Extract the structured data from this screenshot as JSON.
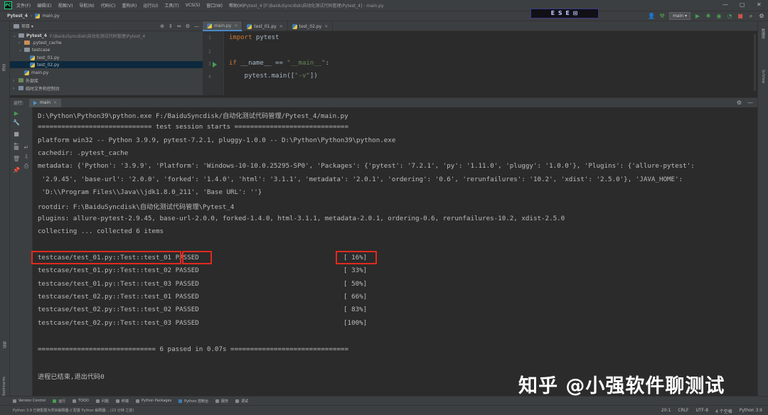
{
  "titlebar": {
    "menu": [
      "文件(F)",
      "编辑(E)",
      "视图(V)",
      "导航(N)",
      "代码(C)",
      "重构(R)",
      "运行(U)",
      "工具(T)",
      "VCS(S)",
      "窗口(W)",
      "帮助(H)"
    ],
    "window_title": "Pytest_4 [F:\\BaiduSyncdisk\\自动化测试代码管理\\Pytest_4] - main.py",
    "logo": "PC",
    "controls": [
      "—",
      "▢",
      "✕"
    ]
  },
  "navbar": {
    "project": "Pytest_4",
    "file": "main.py",
    "banner": "E S E ⊞",
    "run_config": "main ▾"
  },
  "project_panel": {
    "header": "项目 ▾",
    "tree": [
      {
        "label": "Pytest_4",
        "path": "F:\\BaiduSyncdisk\\自动化测试代码管理\\Pytest_4",
        "kind": "folder",
        "expanded": true,
        "indent": 0
      },
      {
        "label": ".pytest_cache",
        "path": "",
        "kind": "folder-excl",
        "expanded": false,
        "indent": 1
      },
      {
        "label": "testcase",
        "path": "",
        "kind": "folder",
        "expanded": true,
        "indent": 1
      },
      {
        "label": "test_01.py",
        "path": "",
        "kind": "py",
        "indent": 2
      },
      {
        "label": "test_02.py",
        "path": "",
        "kind": "py",
        "indent": 2,
        "selected": true
      },
      {
        "label": "main.py",
        "path": "",
        "kind": "py",
        "indent": 1
      },
      {
        "label": "外部库",
        "path": "",
        "kind": "lib",
        "expanded": false,
        "indent": 0
      },
      {
        "label": "临时文件和控制台",
        "path": "",
        "kind": "lib",
        "expanded": false,
        "indent": 0
      }
    ]
  },
  "editor": {
    "tabs": [
      "main.py",
      "test_01.py",
      "test_02.py"
    ],
    "active_tab": 0,
    "line_numbers": [
      "1",
      "2",
      "3",
      "4"
    ]
  },
  "run_panel": {
    "label": "运行:",
    "tab": "main"
  },
  "console": {
    "lines": [
      "D:\\Python\\Python39\\python.exe F:/BaiduSyncdisk/自动化测试代码管理/Pytest_4/main.py",
      "============================= test session starts =============================",
      "platform win32 -- Python 3.9.9, pytest-7.2.1, pluggy-1.0.0 -- D:\\Python\\Python39\\python.exe",
      "cachedir: .pytest_cache",
      "metadata: {'Python': '3.9.9', 'Platform': 'Windows-10-10.0.25295-SP0', 'Packages': {'pytest': '7.2.1', 'py': '1.11.0', 'pluggy': '1.0.0'}, 'Plugins': {'allure-pytest':",
      " '2.9.45', 'base-url': '2.0.0', 'forked': '1.4.0', 'html': '3.1.1', 'metadata': '2.0.1', 'ordering': '0.6', 'rerunfailures': '10.2', 'xdist': '2.5.0'}, 'JAVA_HOME':",
      " 'D:\\\\Program Files\\\\Java\\\\jdk1.8.0_211', 'Base URL': ''}",
      "rootdir: F:\\BaiduSyncdisk\\自动化测试代码管理\\Pytest_4",
      "plugins: allure-pytest-2.9.45, base-url-2.0.0, forked-1.4.0, html-3.1.1, metadata-2.0.1, ordering-0.6, rerunfailures-10.2, xdist-2.5.0",
      "collecting ... collected 6 items"
    ],
    "results": [
      {
        "test": "testcase/test_01.py::Test::test_01 PASSED",
        "pct": "[ 16%]"
      },
      {
        "test": "testcase/test_01.py::Test::test_02 PASSED",
        "pct": "[ 33%]"
      },
      {
        "test": "testcase/test_01.py::Test::test_03 PASSED",
        "pct": "[ 50%]"
      },
      {
        "test": "testcase/test_02.py::Test::test_01 PASSED",
        "pct": "[ 66%]"
      },
      {
        "test": "testcase/test_02.py::Test::test_02 PASSED",
        "pct": "[ 83%]"
      },
      {
        "test": "testcase/test_02.py::Test::test_03 PASSED",
        "pct": "[100%]"
      }
    ],
    "summary": "============================== 6 passed in 0.07s ==============================",
    "exit": "进程已结束,退出代码0"
  },
  "watermark": "知乎 @小强软件聊测试",
  "bottom_tools": [
    "Version Control",
    "运行",
    "TODO",
    "问题",
    "终端",
    "Python Packages",
    "Python 控制台",
    "服务",
    "调试"
  ],
  "statusbar": {
    "message": "Python 3.9 已被配置为项目解释器 // 配置 Python 解释器... (23 分钟 之前)",
    "right": [
      "20:1",
      "CRLF",
      "UTF-8",
      "4 个空格",
      "Python 3.9"
    ]
  },
  "left_strip": {
    "project": "项目",
    "structure": "结构",
    "bookmarks": "Bookmarks"
  },
  "right_strip": [
    "数据库",
    "SciView"
  ],
  "colors": {
    "highlight_box": "#e02a20",
    "keyword": "#cc7832",
    "string": "#6a8759",
    "dunder": "#b200b2",
    "run_green": "#499c54"
  }
}
